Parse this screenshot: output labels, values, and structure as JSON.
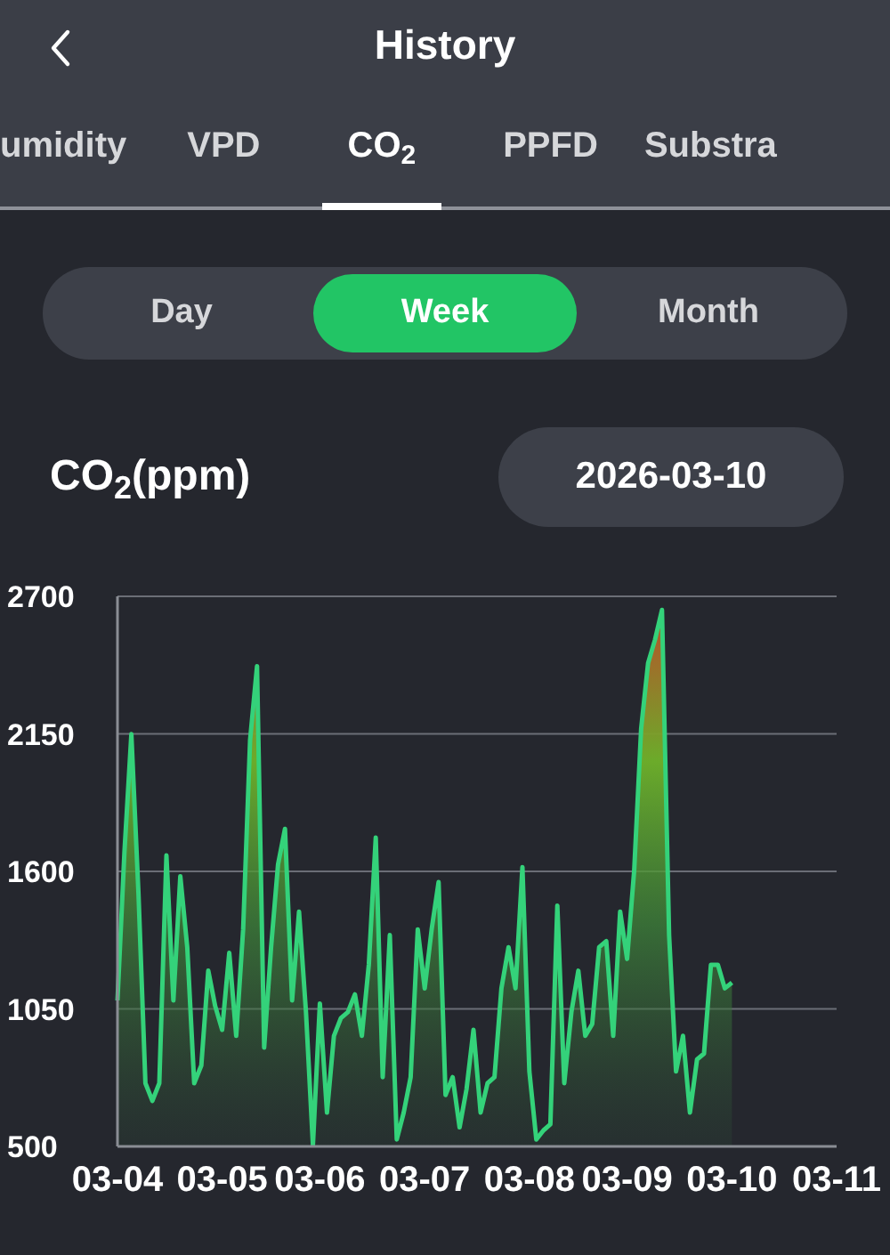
{
  "header": {
    "title": "History"
  },
  "tabs": [
    {
      "label": "umidity",
      "selected": false
    },
    {
      "label": "VPD",
      "selected": false
    },
    {
      "label": "CO$_{2}$",
      "selected": true
    },
    {
      "label": "PPFD",
      "selected": false
    },
    {
      "label": "Substra",
      "selected": false
    }
  ],
  "periods": [
    {
      "label": "Day",
      "selected": false
    },
    {
      "label": "Week",
      "selected": true
    },
    {
      "label": "Month",
      "selected": false
    }
  ],
  "chart_title": "CO$_{2}$(ppm)",
  "date": "2026-03-10",
  "chart_data": {
    "type": "area",
    "grid": true,
    "ylim": [
      500,
      2700
    ],
    "yticks": [
      500,
      1050,
      1600,
      2150,
      2700
    ],
    "categories": [
      "03-04",
      null,
      null,
      null,
      null,
      null,
      null,
      null,
      null,
      null,
      null,
      null,
      null,
      null,
      null,
      "03-05",
      null,
      null,
      null,
      null,
      null,
      null,
      null,
      null,
      null,
      null,
      null,
      null,
      null,
      "03-06",
      null,
      null,
      null,
      null,
      null,
      null,
      null,
      null,
      null,
      null,
      null,
      null,
      null,
      null,
      "03-07",
      null,
      null,
      null,
      null,
      null,
      null,
      null,
      null,
      null,
      null,
      null,
      null,
      null,
      null,
      "03-08",
      null,
      null,
      null,
      null,
      null,
      null,
      null,
      null,
      null,
      null,
      null,
      null,
      null,
      "03-09",
      null,
      null,
      null,
      null,
      null,
      null,
      null,
      null,
      null,
      null,
      null,
      null,
      null,
      null,
      "03-10",
      null,
      null,
      null,
      null,
      null,
      null,
      null,
      null,
      null,
      null,
      null,
      null,
      null,
      null,
      "03-11"
    ],
    "series": [
      {
        "color": "#34d27a",
        "values": [
          1084,
          1676,
          2149,
          1510,
          753,
          682,
          753,
          1664,
          1084,
          1581,
          1297,
          753,
          824,
          1203,
          1061,
          966,
          1274,
          942,
          1368,
          2125,
          2421,
          895,
          1297,
          1628,
          1770,
          1084,
          1439,
          1037,
          505,
          1072,
          635,
          942,
          1013,
          1037,
          1108,
          942,
          1226,
          1735,
          777,
          1345,
          528,
          635,
          777,
          1368,
          1132,
          1368,
          1557,
          706,
          777,
          576,
          729,
          966,
          635,
          753,
          777,
          1132,
          1297,
          1132,
          1617,
          800,
          528,
          564,
          588,
          1463,
          753,
          1037,
          1203,
          942,
          990,
          1297,
          1321,
          942,
          1439,
          1250,
          1605,
          2172,
          2433,
          2527,
          2646,
          1345,
          800,
          942,
          635,
          848,
          871,
          1226,
          1226,
          1132,
          1155,
          null,
          null,
          null,
          null,
          null,
          null,
          null,
          null,
          null,
          null,
          null,
          null,
          null,
          null,
          null
        ]
      }
    ]
  }
}
